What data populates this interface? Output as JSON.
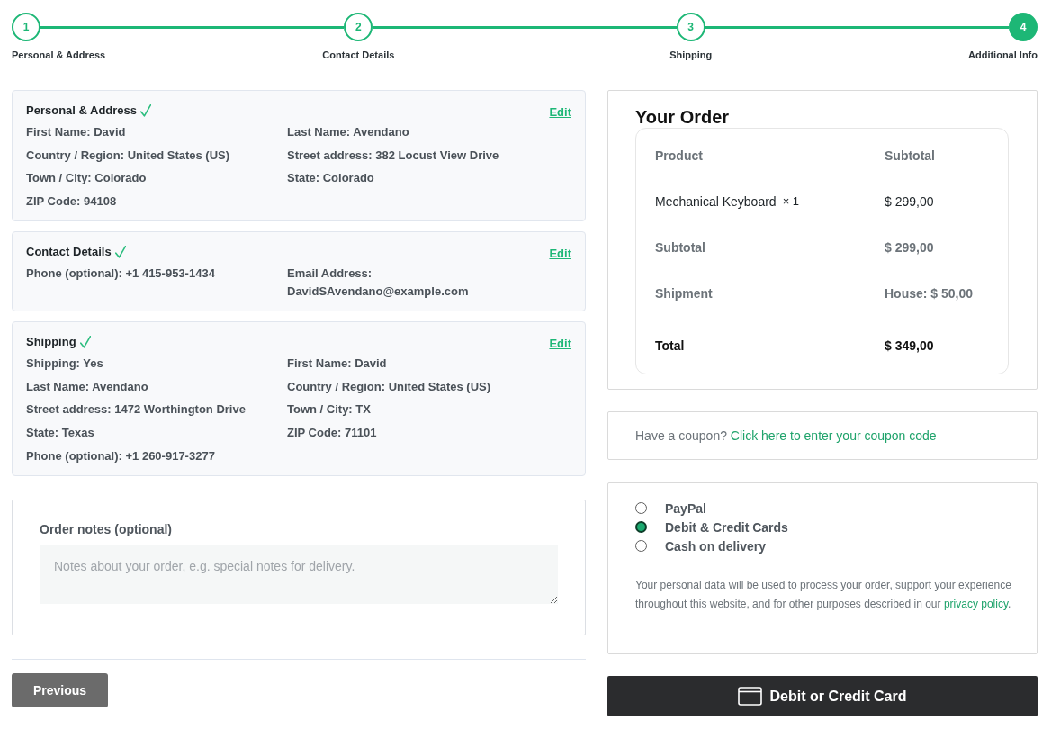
{
  "steps": [
    {
      "number": "1",
      "label": "Personal & Address",
      "selected": false
    },
    {
      "number": "2",
      "label": "Contact Details",
      "selected": false
    },
    {
      "number": "3",
      "label": "Shipping",
      "selected": false
    },
    {
      "number": "4",
      "label": "Additional Info",
      "selected": true
    }
  ],
  "sections": [
    {
      "title": "Personal & Address",
      "completed": true,
      "edit_link": "Edit",
      "fields": [
        "First Name: David",
        "Last Name: Avendano",
        "Country / Region: United States (US)",
        "Street address: 382 Locust View Drive",
        "Town / City: Colorado",
        "State: Colorado",
        "ZIP Code: 94108"
      ]
    },
    {
      "title": "Contact Details",
      "completed": true,
      "edit_link": "Edit",
      "fields": [
        "Phone (optional): +1 415-953-1434",
        "Email Address: DavidSAvendano@example.com"
      ]
    },
    {
      "title": "Shipping",
      "completed": true,
      "edit_link": "Edit",
      "fields": [
        "Shipping: Yes",
        "First Name: David",
        "Last Name: Avendano",
        "Country / Region: United States (US)",
        "Street address: 1472 Worthington Drive",
        "Town / City: TX",
        "State: Texas",
        "ZIP Code: 71101",
        "Phone (optional): +1 260-917-3277"
      ]
    }
  ],
  "order_notes": {
    "label": "Order notes (optional)",
    "placeholder": "Notes about your order, e.g. special notes for delivery."
  },
  "previous_button": "Previous",
  "order": {
    "title": "Your Order",
    "columns": [
      "Product",
      "Subtotal"
    ],
    "rows": [
      {
        "kind": "item",
        "label": "Mechanical Keyboard",
        "quantity": "× 1",
        "value": "$ 299,00"
      },
      {
        "kind": "summary",
        "label": "Subtotal",
        "value": "$ 299,00"
      },
      {
        "kind": "summary",
        "label": "Shipment",
        "value": "House: $ 50,00"
      },
      {
        "kind": "total",
        "label": "Total",
        "value": "$ 349,00"
      }
    ]
  },
  "coupon": {
    "text": "Have a coupon?",
    "link": "Click here to enter your coupon code"
  },
  "payment": {
    "methods": [
      {
        "label": "PayPal",
        "selected": false
      },
      {
        "label": "Debit & Credit Cards",
        "selected": true
      },
      {
        "label": "Cash on delivery",
        "selected": false
      }
    ],
    "privacy_text": "Your personal data will be used to process your order, support your experience throughout this website, and for other purposes described in our",
    "privacy_link": "privacy policy",
    "privacy_end": "."
  },
  "pay_button": "Debit or Credit Card"
}
